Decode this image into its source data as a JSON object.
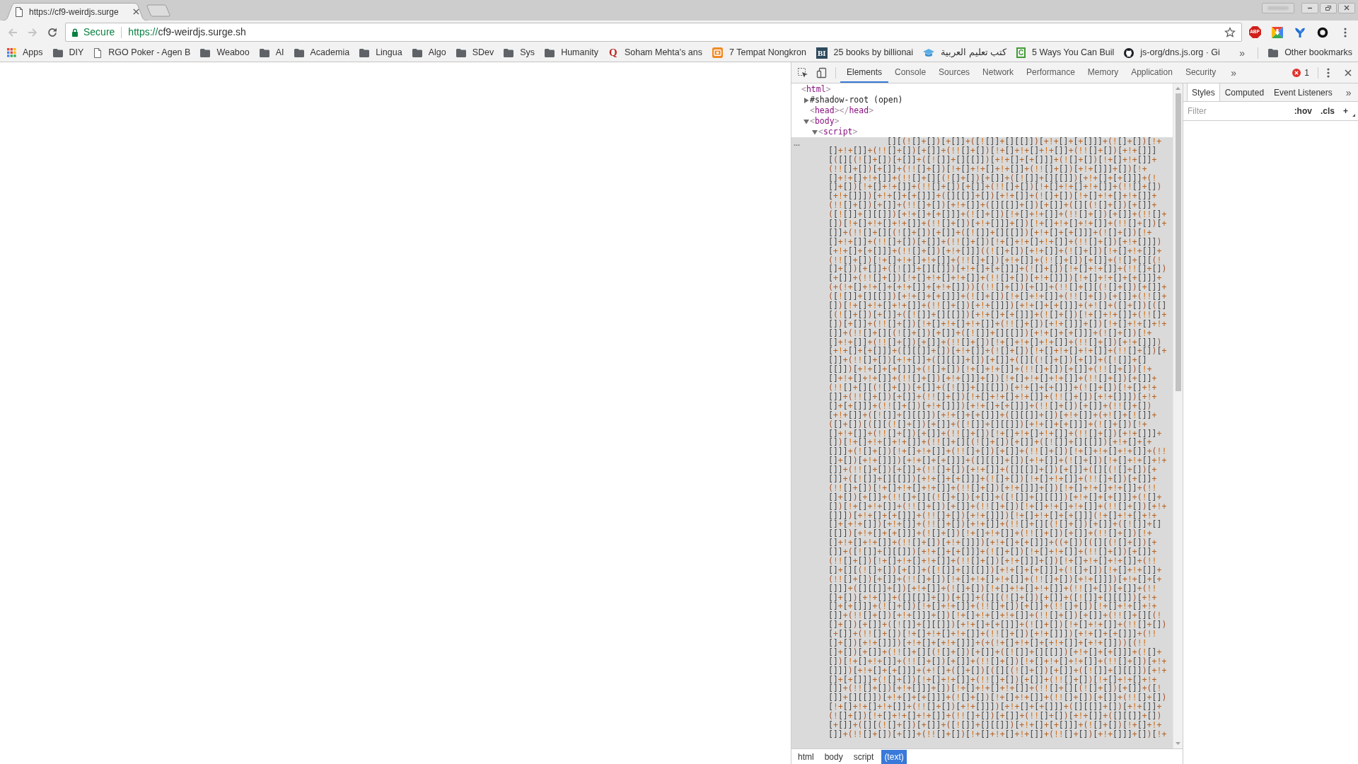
{
  "browser": {
    "tab": {
      "title": "https://cf9-weirdjs.surge"
    },
    "nav": [
      {
        "kind": "back",
        "disabled": true
      },
      {
        "kind": "forward",
        "disabled": true
      },
      {
        "kind": "reload",
        "disabled": false
      }
    ],
    "address": {
      "security": "Secure",
      "scheme": "https://",
      "host": "cf9-weirdjs.surge.sh"
    },
    "extensions": [
      {
        "kind": "adblock",
        "label": "ABP"
      },
      {
        "kind": "download"
      },
      {
        "kind": "funnel"
      },
      {
        "kind": "ring"
      }
    ],
    "bookmarks": [
      {
        "kind": "apps",
        "label": "Apps"
      },
      {
        "kind": "folder",
        "label": "DIY"
      },
      {
        "kind": "page",
        "label": "RGO Poker - Agen B"
      },
      {
        "kind": "folder",
        "label": "Weaboo"
      },
      {
        "kind": "folder",
        "label": "AI"
      },
      {
        "kind": "folder",
        "label": "Academia"
      },
      {
        "kind": "folder",
        "label": "Lingua"
      },
      {
        "kind": "folder",
        "label": "Algo"
      },
      {
        "kind": "folder",
        "label": "SDev"
      },
      {
        "kind": "folder",
        "label": "Sys"
      },
      {
        "kind": "folder",
        "label": "Humanity"
      },
      {
        "kind": "letter",
        "glyph": "Q",
        "label": "Soham Mehta's ans"
      },
      {
        "kind": "tile",
        "label": "7 Tempat Nongkron"
      },
      {
        "kind": "letter-tile",
        "glyph": "BI",
        "label": "25 books by billionai"
      },
      {
        "kind": "cap",
        "label": "كتب تعليم العربية"
      },
      {
        "kind": "letter-box",
        "glyph": "C",
        "label": "5 Ways You Can Buil"
      },
      {
        "kind": "round",
        "label": "js-org/dns.js.org · Gi"
      }
    ],
    "bookmarks_overflow": "»",
    "other_bookmarks": "Other bookmarks"
  },
  "devtools": {
    "tabs": [
      {
        "label": "Elements",
        "selected": true
      },
      {
        "label": "Console",
        "selected": false
      },
      {
        "label": "Sources",
        "selected": false
      },
      {
        "label": "Network",
        "selected": false
      },
      {
        "label": "Performance",
        "selected": false
      },
      {
        "label": "Memory",
        "selected": false
      },
      {
        "label": "Application",
        "selected": false
      },
      {
        "label": "Security",
        "selected": false
      }
    ],
    "tabs_overflow": "»",
    "error_count": "1",
    "dom_tree": [
      {
        "kind": "tag",
        "text": "<html>",
        "children": [
          {
            "kind": "shadow",
            "text": "#shadow-root (open)",
            "expanded": false
          },
          {
            "kind": "tag",
            "text": "<head></head>"
          },
          {
            "kind": "tag",
            "text": "<body>",
            "expanded": true,
            "children": [
              {
                "kind": "tag",
                "text": "<script>",
                "expanded": true,
                "children": [
                  {
                    "kind": "text",
                    "selected": true,
                    "gutter": "...",
                    "lines": [
                      "[][(![]+[])[+[]]+([![]]+[][[]])[+!+[]+[+[]]]+(![]+[])[!+",
                      "[]+!+[]]+(!![]+[])[+[]]+(!![]+[])[!+[]+!+[]+!+[]]+(!![]+[])[+!+[]]]",
                      "[([][(![]+[])[+[]]+([![]]+[][[]])[+!+[]+[+[]]]+(![]+[])[!+[]+!+[]]+",
                      "(!![]+[])[+[]]+(!![]+[])[!+[]+!+[]+!+[]]+(!![]+[])[+!+[]]]+[])[!+",
                      "[]+!+[]+!+[]]+(!![]+[][(![]+[])[+[]]+([![]]+[][[]])[+!+[]+[+[]]]+(!",
                      "[]+[])[!+[]+!+[]]+(!![]+[])[+[]]+(!![]+[])[!+[]+!+[]+!+[]]+(!![]+[])",
                      "[+!+[]]])[+!+[]+[+[]]]+([][[]]+[])[+!+[]]+(![]+[])[!+[]+!+[]+!+[]]+",
                      "(!![]+[])[+[]]+(!![]+[])[+!+[]]+([][[]]+[])[+[]]+([][(![]+[])[+[]]+",
                      "([![]]+[][[]])[+!+[]+[+[]]]+(![]+[])[!+[]+!+[]]+(!![]+[])[+[]]+(!![]+",
                      "[])[!+[]+!+[]+!+[]]+(!![]+[])[+!+[]]]+[])[!+[]+!+[]+!+[]]+(!![]+[])[+",
                      "[]]+(!![]+[][(![]+[])[+[]]+([![]]+[][[]])[+!+[]+[+[]]]+(![]+[])[!+",
                      "[]+!+[]]+(!![]+[])[+[]]+(!![]+[])[!+[]+!+[]+!+[]]+(!![]+[])[+!+[]]])",
                      "[+!+[]+[+[]]]+(!![]+[])[+!+[]]]((![]+[])[+!+[]]+(![]+[])[!+[]+!+[]]+",
                      "(!![]+[])[!+[]+!+[]+!+[]]+(!![]+[])[+!+[]]+(!![]+[])[+[]]+(![]+[][(!",
                      "[]+[])[+[]]+([![]]+[][[]])[+!+[]+[+[]]]+(![]+[])[!+[]+!+[]]+(!![]+[])",
                      "[+[]]+(!![]+[])[!+[]+!+[]+!+[]]+(!![]+[])[+!+[]]])[!+[]+!+[]+[+[]]]+",
                      "(+(!+[]+!+[]+[+!+[]]+[+!+[]]))[(!![]+[])[+[]]+(!![]+[][(![]+[])[+[]]+",
                      "([![]]+[][[]])[+!+[]+[+[]]]+(![]+[])[!+[]+!+[]]+(!![]+[])[+[]]+(!![]+",
                      "[])[!+[]+!+[]+!+[]]+(!![]+[])[+!+[]]])[+!+[]+[+[]]]+(+![]+([]+[])[([]",
                      "[(![]+[])[+[]]+([![]]+[][[]])[+!+[]+[+[]]]+(![]+[])[!+[]+!+[]]+(!![]+",
                      "[])[+[]]+(!![]+[])[!+[]+!+[]+!+[]]+(!![]+[])[+!+[]]]+[])[!+[]+!+[]+!+",
                      "[]]+(!![]+[][(![]+[])[+[]]+([![]]+[][[]])[+!+[]+[+[]]]+(![]+[])[!+",
                      "[]+!+[]]+(!![]+[])[+[]]+(!![]+[])[!+[]+!+[]+!+[]]+(!![]+[])[+!+[]]])",
                      "[+!+[]+[+[]]]+([][[]]+[])[+!+[]]+(![]+[])[!+[]+!+[]+!+[]]+(!![]+[])[+",
                      "[]]+(!![]+[])[+!+[]]+([][[]]+[])[+[]]+([][(![]+[])[+[]]+([![]]+[]",
                      "[[]])[+!+[]+[+[]]]+(![]+[])[!+[]+!+[]]+(!![]+[])[+[]]+(!![]+[])[!+",
                      "[]+!+[]+!+[]]+(!![]+[])[+!+[]]]+[])[!+[]+!+[]+!+[]]+(!![]+[])[+[]]+",
                      "(!![]+[][(![]+[])[+[]]+([![]]+[][[]])[+!+[]+[+[]]]+(![]+[])[!+[]+!+",
                      "[]]+(!![]+[])[+[]]+(!![]+[])[!+[]+!+[]+!+[]]+(!![]+[])[+!+[]]])[+!+",
                      "[]+[+[]]]+(!![]+[])[+!+[]]])[+!+[]+[+[]]]+(!![]+[])[+[]]+(!![]+[])",
                      "[+!+[]]+([![]]+[][[]])[+!+[]+[+[]]]+([][[]]+[])[+!+[]]+(+![]+[![]]+",
                      "([]+[])[([][(![]+[])[+[]]+([![]]+[][[]])[+!+[]+[+[]]]+(![]+[])[!+",
                      "[]+!+[]]+(!![]+[])[+[]]+(!![]+[])[!+[]+!+[]+!+[]]+(!![]+[])[+!+[]]]+",
                      "[])[!+[]+!+[]+!+[]]+(!![]+[][(![]+[])[+[]]+([![]]+[][[]])[+!+[]+[+",
                      "[]]]+(![]+[])[!+[]+!+[]]+(!![]+[])[+[]]+(!![]+[])[!+[]+!+[]+!+[]]+(!!",
                      "[]+[])[+!+[]]])[+!+[]+[+[]]]+([][[]]+[])[+!+[]]+(![]+[])[!+[]+!+[]+!+",
                      "[]]+(!![]+[])[+[]]+(!![]+[])[+!+[]]+([][[]]+[])[+[]]+([][(![]+[])[+",
                      "[]]+([![]]+[][[]])[+!+[]+[+[]]]+(![]+[])[!+[]+!+[]]+(!![]+[])[+[]]+",
                      "(!![]+[])[!+[]+!+[]+!+[]]+(!![]+[])[+!+[]]]+[])[!+[]+!+[]+!+[]]+(!!",
                      "[]+[])[+[]]+(!![]+[][(![]+[])[+[]]+([![]]+[][[]])[+!+[]+[+[]]]+(![]+",
                      "[])[!+[]+!+[]]+(!![]+[])[+[]]+(!![]+[])[!+[]+!+[]+!+[]]+(!![]+[])[+!+",
                      "[]]])[+!+[]+[+[]]]+(!![]+[])[+!+[]]])[!+[]+!+[]+[+[]]](!+[]+!+[]+!+",
                      "[]+[+!+[]])[+!+[]]+(!![]+[])[+!+[]]+(!![]+[][(![]+[])[+[]]+([![]]+[]",
                      "[[]])[+!+[]+[+[]]]+(![]+[])[!+[]+!+[]]+(!![]+[])[+[]]+(!![]+[])[!+",
                      "[]+!+[]+!+[]]+(!![]+[])[+!+[]]])[+!+[]+[+[]]]+((+[])[([][(![]+[])[+",
                      "[]]+([![]]+[][[]])[+!+[]+[+[]]]+(![]+[])[!+[]+!+[]]+(!![]+[])[+[]]+",
                      "(!![]+[])[!+[]+!+[]+!+[]]+(!![]+[])[+!+[]]]+[])[!+[]+!+[]+!+[]]+(!!",
                      "[]+[][(![]+[])[+[]]+([![]]+[][[]])[+!+[]+[+[]]]+(![]+[])[!+[]+!+[]]+",
                      "(!![]+[])[+[]]+(!![]+[])[!+[]+!+[]+!+[]]+(!![]+[])[+!+[]]])[+!+[]+[+",
                      "[]]]+([][[]]+[])[+!+[]]+(![]+[])[!+[]+!+[]+!+[]]+(!![]+[])[+[]]+(!!",
                      "[]+[])[+!+[]]+([][[]]+[])[+[]]+([][(![]+[])[+[]]+([![]]+[][[]])[+!+",
                      "[]+[+[]]]+(![]+[])[!+[]+!+[]]+(!![]+[])[+[]]+(!![]+[])[!+[]+!+[]+!+",
                      "[]]+(!![]+[])[+!+[]]]+[])[!+[]+!+[]+!+[]]+(!![]+[])[+[]]+(!![]+[][(!",
                      "[]+[])[+[]]+([![]]+[][[]])[+!+[]+[+[]]]+(![]+[])[!+[]+!+[]]+(!![]+[])",
                      "[+[]]+(!![]+[])[!+[]+!+[]+!+[]]+(!![]+[])[+!+[]]])[+!+[]+[+[]]]+(!!",
                      "[]+[])[+!+[]]])[+!+[]+[+!+[]]]+(+(!+[]+!+[]+[+!+[]]+[+!+[]]))[(!!",
                      "[]+[])[+[]]+(!![]+[][(![]+[])[+[]]+([![]]+[][[]])[+!+[]+[+[]]]+(![]+",
                      "[])[!+[]+!+[]]+(!![]+[])[+[]]+(!![]+[])[!+[]+!+[]+!+[]]+(!![]+[])[+!+",
                      "[]]])[+!+[]+[+[]]]+(+![]+([]+[])[([][(![]+[])[+[]]+([![]]+[][[]])[+!+",
                      "[]+[+[]]]+(![]+[])[!+[]+!+[]]+(!![]+[])[+[]]+(!![]+[])[!+[]+!+[]+!+",
                      "[]]+(!![]+[])[+!+[]]]+[])[!+[]+!+[]+!+[]]+(!![]+[][(![]+[])[+[]]+([!",
                      "[]]+[][[]])[+!+[]+[+[]]]+(![]+[])[!+[]+!+[]]+(!![]+[])[+[]]+(!![]+[])",
                      "[!+[]+!+[]+!+[]]+(!![]+[])[+!+[]]])[+!+[]+[+[]]]+([][[]]+[])[+!+[]]+",
                      "(![]+[])[!+[]+!+[]+!+[]]+(!![]+[])[+[]]+(!![]+[])[+!+[]]+([][[]]+[])",
                      "[+[]]+([][(![]+[])[+[]]+([![]]+[][[]])[+!+[]+[+[]]]+(![]+[])[!+[]+!+",
                      "[]]+(!![]+[])[+[]]+(!![]+[])[!+[]+!+[]+!+[]]+(!![]+[])[+!+[]]]+[])[!+"
                    ]
                  }
                ]
              }
            ]
          }
        ]
      }
    ],
    "breadcrumbs": [
      {
        "label": "html",
        "selected": false
      },
      {
        "label": "body",
        "selected": false
      },
      {
        "label": "script",
        "selected": false
      },
      {
        "label": "(text)",
        "selected": true
      }
    ],
    "sidebar": {
      "tabs": [
        {
          "label": "Styles",
          "selected": true
        },
        {
          "label": "Computed",
          "selected": false
        },
        {
          "label": "Event Listeners",
          "selected": false
        }
      ],
      "tabs_overflow": "»",
      "filter": {
        "placeholder": "Filter"
      },
      "buttons": [
        ":hov",
        ".cls",
        "+"
      ]
    }
  }
}
